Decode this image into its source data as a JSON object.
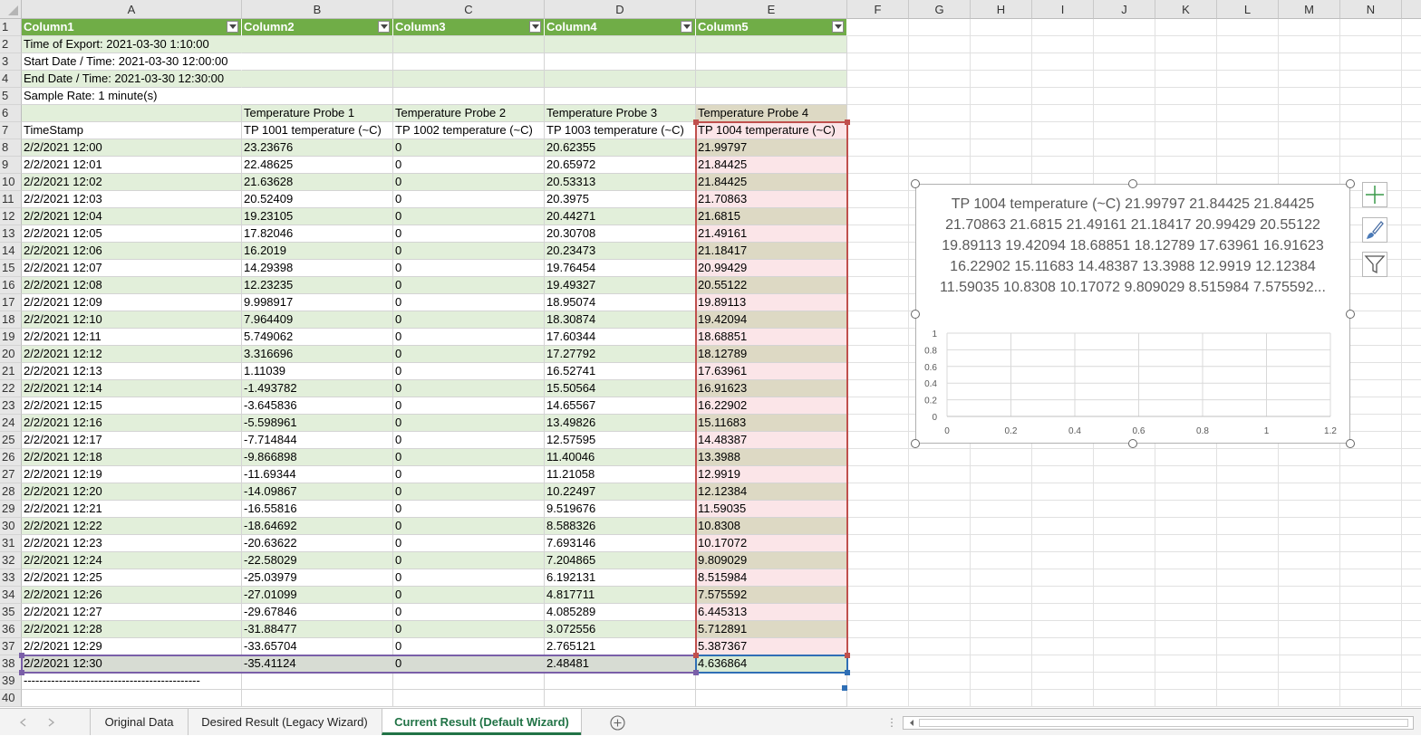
{
  "columns": [
    "A",
    "B",
    "C",
    "D",
    "E",
    "F",
    "G",
    "H",
    "I",
    "J",
    "K",
    "L",
    "M",
    "N"
  ],
  "row_numbers": [
    "1",
    "2",
    "3",
    "4",
    "5",
    "6",
    "7",
    "8",
    "9",
    "10",
    "11",
    "12",
    "13",
    "14",
    "15",
    "16",
    "17",
    "18",
    "19",
    "20",
    "21",
    "22",
    "23",
    "24",
    "25",
    "26",
    "27",
    "28",
    "29",
    "30",
    "31",
    "32",
    "33",
    "34",
    "35",
    "36",
    "37",
    "38",
    "39",
    "40"
  ],
  "table_headers": [
    "Column1",
    "Column2",
    "Column3",
    "Column4",
    "Column5"
  ],
  "meta_rows": [
    "Time of Export: 2021-03-30 1:10:00",
    "Start Date / Time: 2021-03-30 12:00:00",
    "End Date / Time: 2021-03-30 12:30:00",
    "Sample Rate: 1 minute(s)"
  ],
  "probe_row": [
    "",
    "Temperature Probe 1",
    "Temperature Probe 2",
    "Temperature Probe 3",
    "Temperature Probe 4"
  ],
  "label_row": [
    "TimeStamp",
    "TP 1001 temperature (~C)",
    "TP 1002 temperature (~C)",
    "TP 1003 temperature (~C)",
    "TP 1004 temperature (~C)"
  ],
  "data_rows": [
    [
      "2/2/2021 12:00",
      "23.23676",
      "0",
      "20.62355",
      "21.99797"
    ],
    [
      "2/2/2021 12:01",
      "22.48625",
      "0",
      "20.65972",
      "21.84425"
    ],
    [
      "2/2/2021 12:02",
      "21.63628",
      "0",
      "20.53313",
      "21.84425"
    ],
    [
      "2/2/2021 12:03",
      "20.52409",
      "0",
      "20.3975",
      "21.70863"
    ],
    [
      "2/2/2021 12:04",
      "19.23105",
      "0",
      "20.44271",
      "21.6815"
    ],
    [
      "2/2/2021 12:05",
      "17.82046",
      "0",
      "20.30708",
      "21.49161"
    ],
    [
      "2/2/2021 12:06",
      "16.2019",
      "0",
      "20.23473",
      "21.18417"
    ],
    [
      "2/2/2021 12:07",
      "14.29398",
      "0",
      "19.76454",
      "20.99429"
    ],
    [
      "2/2/2021 12:08",
      "12.23235",
      "0",
      "19.49327",
      "20.55122"
    ],
    [
      "2/2/2021 12:09",
      "9.998917",
      "0",
      "18.95074",
      "19.89113"
    ],
    [
      "2/2/2021 12:10",
      "7.964409",
      "0",
      "18.30874",
      "19.42094"
    ],
    [
      "2/2/2021 12:11",
      "5.749062",
      "0",
      "17.60344",
      "18.68851"
    ],
    [
      "2/2/2021 12:12",
      "3.316696",
      "0",
      "17.27792",
      "18.12789"
    ],
    [
      "2/2/2021 12:13",
      "1.11039",
      "0",
      "16.52741",
      "17.63961"
    ],
    [
      "2/2/2021 12:14",
      "-1.493782",
      "0",
      "15.50564",
      "16.91623"
    ],
    [
      "2/2/2021 12:15",
      "-3.645836",
      "0",
      "14.65567",
      "16.22902"
    ],
    [
      "2/2/2021 12:16",
      "-5.598961",
      "0",
      "13.49826",
      "15.11683"
    ],
    [
      "2/2/2021 12:17",
      "-7.714844",
      "0",
      "12.57595",
      "14.48387"
    ],
    [
      "2/2/2021 12:18",
      "-9.866898",
      "0",
      "11.40046",
      "13.3988"
    ],
    [
      "2/2/2021 12:19",
      "-11.69344",
      "0",
      "11.21058",
      "12.9919"
    ],
    [
      "2/2/2021 12:20",
      "-14.09867",
      "0",
      "10.22497",
      "12.12384"
    ],
    [
      "2/2/2021 12:21",
      "-16.55816",
      "0",
      "9.519676",
      "11.59035"
    ],
    [
      "2/2/2021 12:22",
      "-18.64692",
      "0",
      "8.588326",
      "10.8308"
    ],
    [
      "2/2/2021 12:23",
      "-20.63622",
      "0",
      "7.693146",
      "10.17072"
    ],
    [
      "2/2/2021 12:24",
      "-22.58029",
      "0",
      "7.204865",
      "9.809029"
    ],
    [
      "2/2/2021 12:25",
      "-25.03979",
      "0",
      "6.192131",
      "8.515984"
    ],
    [
      "2/2/2021 12:26",
      "-27.01099",
      "0",
      "4.817711",
      "7.575592"
    ],
    [
      "2/2/2021 12:27",
      "-29.67846",
      "0",
      "4.085289",
      "6.445313"
    ],
    [
      "2/2/2021 12:28",
      "-31.88477",
      "0",
      "3.072556",
      "5.712891"
    ],
    [
      "2/2/2021 12:29",
      "-33.65704",
      "0",
      "2.765121",
      "5.387367"
    ],
    [
      "2/2/2021 12:30",
      "-35.41124",
      "0",
      "2.48481",
      "4.636864"
    ]
  ],
  "row39_text": "---------------------------------------------",
  "chart": {
    "title": "TP 1004 temperature (~C) 21.99797 21.84425 21.84425 21.70863 21.6815 21.49161 21.18417 20.99429 20.55122 19.89113 19.42094 18.68851 18.12789 17.63961 16.91623 16.22902 15.11683 14.48387 13.3988 12.9919 12.12384 11.59035 10.8308 10.17072 9.809029 8.515984 7.575592..."
  },
  "chart_data": {
    "type": "scatter",
    "title": "TP 1004 temperature (~C) 21.99797 21.84425 21.84425 21.70863 21.6815 21.49161 21.18417 20.99429 20.55122 19.89113 19.42094 18.68851 18.12789 17.63961 16.91623 16.22902 15.11683 14.48387 13.3988 12.9919 12.12384 11.59035 10.8308 10.17072 9.809029 8.515984 7.575592...",
    "x": [],
    "y": [],
    "xlim": [
      0,
      1.2
    ],
    "ylim": [
      0,
      1
    ],
    "x_ticks": [
      "0",
      "0.2",
      "0.4",
      "0.6",
      "0.8",
      "1",
      "1.2"
    ],
    "y_ticks": [
      "0",
      "0.2",
      "0.4",
      "0.6",
      "0.8",
      "1"
    ],
    "grid": true
  },
  "sheet_tabs": [
    "Original Data",
    "Desired Result (Legacy Wizard)",
    "Current Result (Default Wizard)"
  ],
  "active_tab_index": 2,
  "icons": {
    "add_sheet": "plus-circle-icon",
    "chart_elements": "plus-icon",
    "chart_styles": "brush-icon",
    "chart_filters": "funnel-icon"
  },
  "colors": {
    "header_green": "#70ad47",
    "band_green": "#e2efda",
    "selection_red": "#c0504d",
    "active_tab": "#217346"
  }
}
